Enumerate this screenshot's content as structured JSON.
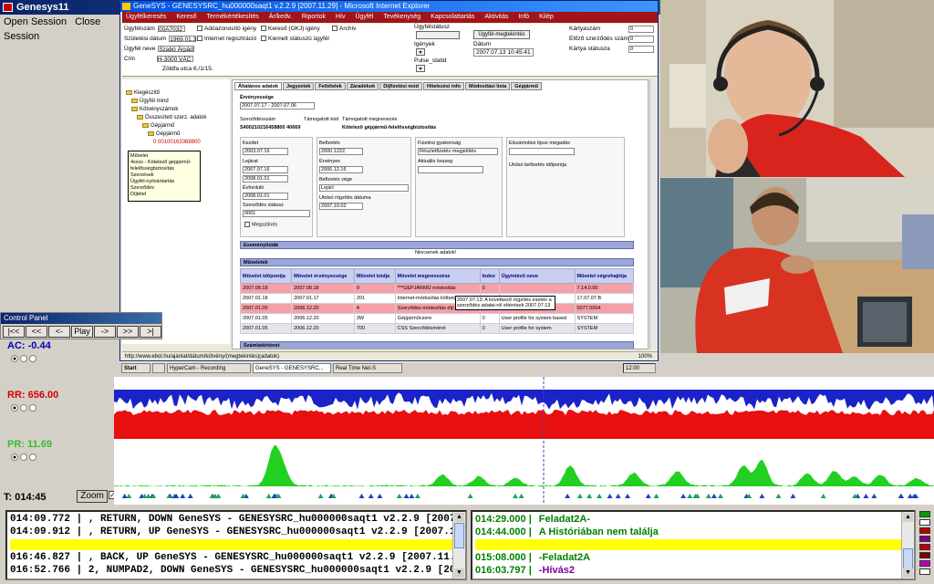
{
  "app": {
    "title": "Genesys11",
    "menu": [
      "Open Session",
      "Close Session"
    ]
  },
  "ie": {
    "title": "GeneSYS - GENESYSRC_hu000000saqt1 v.2.2.9 [2007.11.29] - Microsoft Internet Explorer",
    "menubar": [
      "Ügyfélkeresés",
      "Kereső",
      "Termékértékesítés",
      "Ár/kedv.",
      "Riportok",
      "Hív",
      "Ügyfél",
      "Tevékenység",
      "Kapcsolattartás",
      "Aktivitás",
      "Infó",
      "Kilép"
    ],
    "header": {
      "fields": [
        {
          "label": "Ügyfélszám",
          "value": "00A7032"
        },
        {
          "label": "Születési dátum",
          "value": "1969.01.31"
        },
        {
          "label": "Ügyfél neve",
          "value": "Szabó Árpád"
        },
        {
          "label": "Cím",
          "value": "H-3000 VÁC"
        }
      ],
      "address_line": "Zöldfa utca 6./1/15.",
      "checkboxes": [
        "Adóazonosító igény",
        "Internet regisztráció",
        "Kereső (OKJ) igény",
        "Kiemelt státuszú ügyfél",
        "Archív"
      ],
      "middle_labels": [
        "Ügyfélstátusz",
        "Igények",
        "Pulse_statid",
        "Dátum"
      ],
      "date_button": "Ügyfél-megtekintés",
      "date_value": "2007.07.13 10:45:41",
      "right_labels": [
        "Kártyaszám",
        "Előző szerződés szám",
        "Kártya státusza"
      ],
      "right_values": [
        "0",
        "0",
        "0"
      ]
    },
    "tree": {
      "items": [
        "Kiegészítő",
        "Ügyfél mind",
        "Kötvényszámok",
        "Összesített szerz. adatok",
        "Gépjármű",
        "Gépjármű"
      ],
      "code": "0 00100163368800",
      "tooltip": "Művelet\n4xxxx - Kötelező gépjármű-felelősségbiztosítás\nSzerzések\nÜgyfél-nyilvántartás\nSzerződés\nDíjtétel"
    },
    "tabs": [
      "Általános adatok",
      "Jegyzetek",
      "Feltételek",
      "Záradékok",
      "Díjfizetési mód",
      "Hitelezési info",
      "Módosítási lista",
      "Gépjármű"
    ],
    "main": {
      "period_label": "Érvényessége",
      "period_value": "2007.07.17 - 2007.07.06",
      "contract_label": "Szerződésszám",
      "contract_value": "S400210216458800 40669",
      "claim_label": "Támogatott kód",
      "claim_value": "Támogatott megnevezés",
      "product": "Kötelező gépjármű-felelősségbiztosítás",
      "fields_left": [
        {
          "label": "Kezdet",
          "value": "2003.07.16"
        },
        {
          "label": "Lejárat",
          "value": "2007.07.16"
        },
        {
          "label": "",
          "value": "2008.01.01"
        },
        {
          "label": "Évforduló",
          "value": "2008.01.01"
        },
        {
          "label": "Szerződés státusz",
          "value": "0001"
        }
      ],
      "fields_mid": [
        {
          "label": "Befizetés",
          "value": "2000.1222."
        },
        {
          "label": "Érvényes",
          "value": "2006.12.16"
        },
        {
          "label": "Befizetés vége",
          "value": "Lejárt"
        },
        {
          "label": "Utolsó rögzítés dátuma",
          "value": "2007.10.02"
        }
      ],
      "extra_checkbox": "Megszűnés",
      "panel_right_labels": [
        "Fizetési gyakoriság",
        "Részletfizetés megjelölés",
        "Aktuális összeg"
      ],
      "panel_right_values": [
        "",
        "Részletfizetés megjelölés",
        ""
      ],
      "panel_far_labels": [
        "Elszámolási típus megadás",
        "Utolsó befizetés időpontja"
      ],
      "section_event": "Eseménylisták",
      "no_data": "Nincsenek adatok!",
      "section_history": "Műveletek",
      "grid_headers": [
        "Művelet időpontja",
        "Művelet érvényessége",
        "Művelet kódja",
        "Művelet megnevezése",
        "Index",
        "Ügyintéző neve",
        "Művelet végrehajtója"
      ],
      "grid_rows": [
        {
          "style": "pink",
          "cells": [
            "2007.08.18",
            "2007.08.18",
            "0",
            "***GEPJÁRMŰ módosítás",
            "0",
            "",
            "7.14.0.00"
          ]
        },
        {
          "style": "white",
          "cells": [
            "2007.01.18",
            "2007.01.17",
            "201",
            "Internet-módosítás költségi indok",
            "0",
            "",
            "17.07.07.B"
          ]
        },
        {
          "style": "pink",
          "cells": [
            "2007.01.05",
            "2006.12.20",
            "4",
            "Szerződés-módosítás díjr.",
            "0",
            "",
            "0077.0004"
          ]
        },
        {
          "style": "white",
          "cells": [
            "2007.01.05",
            "2006.12.20",
            "3W",
            "Gépjárműcsere",
            "0",
            "User profile for system based",
            "SYSTEM"
          ]
        },
        {
          "style": "gray",
          "cells": [
            "2007.01.05",
            "2006.12.20",
            "700",
            "CSS Szerződésméret",
            "0",
            "User profile for system",
            "SYSTEM"
          ]
        }
      ],
      "grid_tooltip": "2007.07.13: A következő rögzítés esetén a szerződés adatai-ról eltérések 2007.07.13",
      "section_footer": "Számlatörténet"
    },
    "status_text": "http://www.ebol.hu/ajánlat/dátum/kötvény/(megtekintés)(adatok)",
    "status_zoom": "100%"
  },
  "taskbar": {
    "items": [
      "Start",
      "",
      "HyperCam - Recording",
      "GeneSYS - GENESYSRC...",
      "Real Time Net-S"
    ],
    "clock": "12:00"
  },
  "video": {
    "top_label": "webcam-face",
    "bottom_label": "webcam-desk"
  },
  "control_panel": {
    "title": "Control Panel",
    "buttons": [
      "|<<",
      "<<",
      "<-",
      "Play",
      "->",
      ">>",
      ">|"
    ]
  },
  "channels": [
    {
      "id": "AC",
      "label": "AC:",
      "value": "-0.44",
      "color": "#0000c0"
    },
    {
      "id": "RR",
      "label": "RR:",
      "value": "656.00",
      "color": "#d00000"
    },
    {
      "id": "PR",
      "label": "PR:",
      "value": "11.69",
      "color": "#30c030"
    }
  ],
  "time_label": "T: 014:45",
  "zoom_label": "Zoom",
  "zoom_checked": "✓",
  "log_left": [
    {
      "text": "014:09.772 |  , RETURN, DOWN  GeneSYS - GENESYSRC_hu000000saqt1 v2.2.9 [2007.11.29",
      "bg": ""
    },
    {
      "text": "014:09.912 |  , RETURN, UP   GeneSYS - GENESYSRC_hu000000saqt1 v2.2.9 [2007.11.29",
      "bg": ""
    },
    {
      "text": "",
      "bg": "#ffff00"
    },
    {
      "text": "016:46.827 |  , BACK, UP  GeneSYS - GENESYSRC_hu000000saqt1 v2.2.9 [2007.11.29] - Mi",
      "bg": ""
    },
    {
      "text": "016:52.766 | 2, NUMPAD2, DOWN  GeneSYS - GENESYSRC_hu000000saqt1 v2.2.9 [2007.11.29",
      "bg": ""
    }
  ],
  "log_right": [
    {
      "time": "014:29.000 |",
      "text": "Feladat2A-",
      "color": "#008000",
      "bg": ""
    },
    {
      "time": "014:44.000 |",
      "text": "A Históriában nem találja",
      "color": "#008000",
      "bg": ""
    },
    {
      "time": "",
      "text": "",
      "color": "#008000",
      "bg": "#ffff00"
    },
    {
      "time": "015:08.000 |",
      "text": "-Feladat2A",
      "color": "#008000",
      "bg": ""
    },
    {
      "time": "016:03.797 |",
      "text": "-Hívás2",
      "color": "#7b00a0",
      "bg": ""
    }
  ],
  "swatch_colors": [
    "#00a000",
    "#ffffff",
    "#c00000",
    "#800080",
    "#c00000",
    "#800000",
    "#c000c0",
    "#ffffff"
  ]
}
